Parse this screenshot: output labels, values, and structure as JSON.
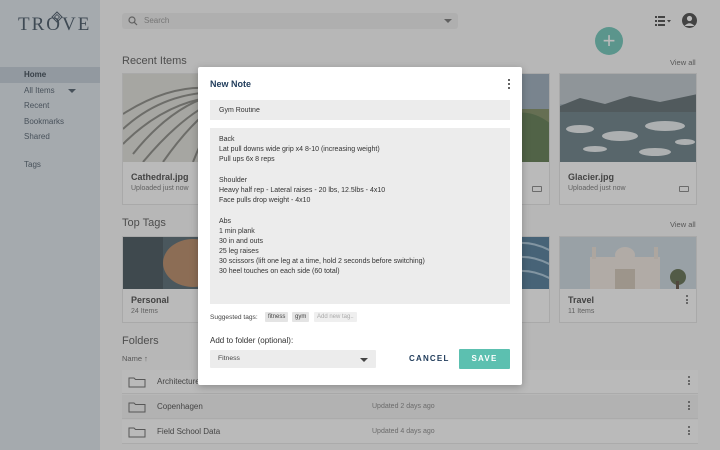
{
  "app": {
    "logo": "TROVE"
  },
  "sidebar": {
    "items": [
      {
        "label": "Home"
      },
      {
        "label": "All Items"
      },
      {
        "label": "Recent"
      },
      {
        "label": "Bookmarks"
      },
      {
        "label": "Shared"
      },
      {
        "label": "Tags"
      }
    ]
  },
  "topbar": {
    "search_placeholder": "Search"
  },
  "recent": {
    "title": "Recent Items",
    "view_all": "View all",
    "cards": [
      {
        "title": "Cathedral.jpg",
        "sub": "Uploaded just now"
      },
      {
        "title": "Glacier.jpg",
        "sub": "Uploaded just now"
      }
    ]
  },
  "tags": {
    "title": "Top Tags",
    "view_all": "View all",
    "cards": [
      {
        "title": "Personal",
        "sub": "24 Items"
      },
      {
        "title": "Travel",
        "sub": "11 Items"
      }
    ]
  },
  "folders": {
    "title": "Folders",
    "sort_label": "Name ↑",
    "rows": [
      {
        "name": "Architecture",
        "date": ""
      },
      {
        "name": "Copenhagen",
        "date": "Updated 2 days ago"
      },
      {
        "name": "Field School Data",
        "date": "Updated 4 days ago"
      }
    ]
  },
  "modal": {
    "title": "New Note",
    "note_title": "Gym Routine",
    "note_lines": [
      "Back",
      "Lat pull downs wide grip x4 8-10 (increasing weight)",
      "Pull ups 6x 8 reps",
      "",
      "Shoulder",
      "Heavy half rep - Lateral raises - 20 lbs, 12.5lbs - 4x10",
      "Face pulls drop weight - 4x10",
      "",
      "Abs",
      "1 min plank",
      "30 in and outs",
      "25 leg raises",
      "30 scissors (lift one leg at a time, hold 2 seconds before switching)",
      "30 heel touches on each side (60 total)"
    ],
    "suggested_label": "Suggested tags:",
    "suggested_tags": [
      "fitness",
      "gym"
    ],
    "add_tag_placeholder": "Add new tag..",
    "folder_label": "Add to folder (optional):",
    "folder_value": "Fitness",
    "cancel_label": "CANCEL",
    "save_label": "SAVE"
  },
  "colors": {
    "accent": "#5cc0b0",
    "navy": "#1f3b5a",
    "sidebar": "#dbe3ea"
  }
}
